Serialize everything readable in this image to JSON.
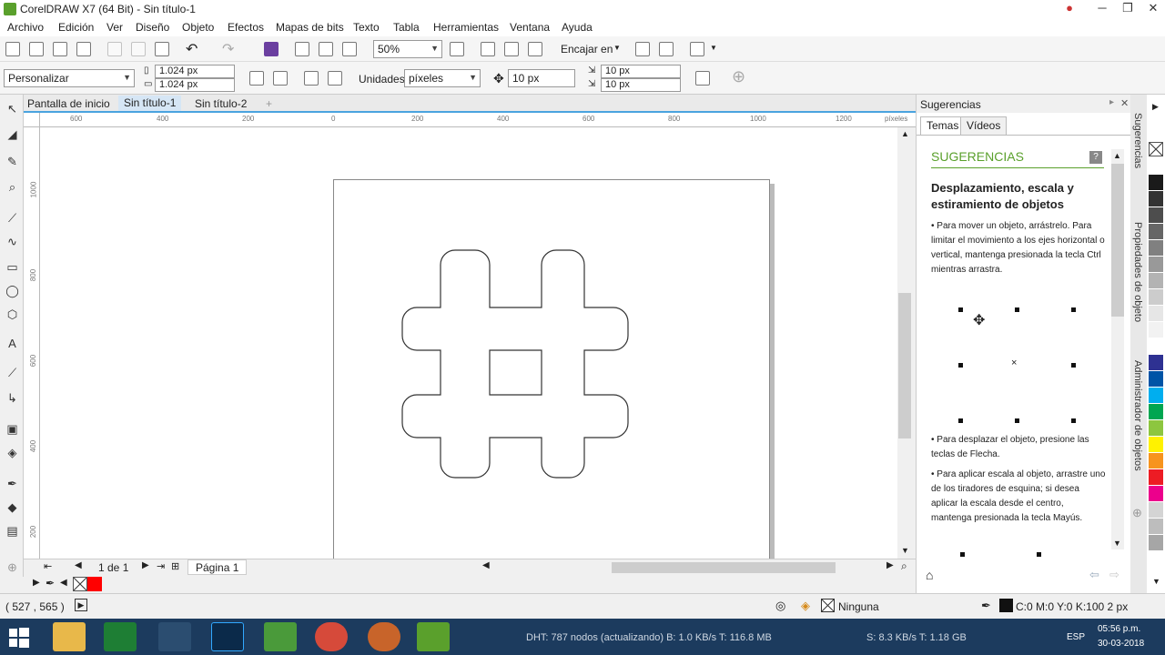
{
  "window": {
    "title": "CorelDRAW X7 (64 Bit) - Sin título-1"
  },
  "menu": [
    "Archivo",
    "Edición",
    "Ver",
    "Diseño",
    "Objeto",
    "Efectos",
    "Mapas de bits",
    "Texto",
    "Tabla",
    "Herramientas",
    "Ventana",
    "Ayuda"
  ],
  "toolbar": {
    "zoom": "50%",
    "snap": "Encajar en"
  },
  "propbar": {
    "preset": "Personalizar",
    "width": "1.024 px",
    "height": "1.024 px",
    "units_label": "Unidades:",
    "units": "píxeles",
    "nudge": "10 px",
    "dup_x": "10 px",
    "dup_y": "10 px"
  },
  "tabs": [
    "Pantalla de inicio",
    "Sin título-1",
    "Sin título-2"
  ],
  "ruler": {
    "h": [
      "600",
      "400",
      "200",
      "0",
      "200",
      "400",
      "600",
      "800",
      "1000",
      "1200"
    ],
    "h_unit": "píxeles",
    "v": [
      "1000",
      "800",
      "600",
      "400",
      "200"
    ],
    "v_unit": "píxeles"
  },
  "pagenav": {
    "counter": "1 de 1",
    "page": "Página 1"
  },
  "status": {
    "coords": "( 527  , 565  )",
    "fill": "Ninguna",
    "outline": "C:0 M:0 Y:0 K:100  2 px"
  },
  "docker": {
    "title": "Sugerencias",
    "tabs": [
      "Temas",
      "Vídeos"
    ],
    "heading": "SUGERENCIAS",
    "topic": "Desplazamiento, escala y estiramiento de objetos",
    "p1": "• Para mover un objeto, arrástrelo. Para limitar el movimiento a los ejes horizontal o vertical, mantenga presionada la tecla Ctrl mientras arrastra.",
    "p2": "• Para desplazar el objeto, presione las teclas de Flecha.",
    "p3": "• Para aplicar escala al objeto, arrastre uno de los tiradores de esquina; si desea aplicar la escala desde el centro, mantenga presionada la tecla Mayús."
  },
  "side_tabs": [
    "Sugerencias",
    "Propiedades de objeto",
    "Administrador de objetos"
  ],
  "palette": [
    "#ffffff",
    "#1a1a1a",
    "#333333",
    "#4d4d4d",
    "#666666",
    "#808080",
    "#999999",
    "#b3b3b3",
    "#cccccc",
    "#e6e6e6",
    "#f2f2f2",
    "#ffffff",
    "#2e3192",
    "#0054a6",
    "#00aeef",
    "#00a651",
    "#8dc63f",
    "#fff200",
    "#f7941d",
    "#ed1c24",
    "#ec008c",
    "#d4d4d4",
    "#bdbdbd",
    "#a6a6a6"
  ],
  "taskbar": {
    "net": "DHT: 787 nodos  (actualizando)    B: 1.0 KB/s T: 116.8 MB",
    "speed": "S: 8.3 KB/s T: 1.18 GB",
    "lang": "ESP",
    "time": "05:56 p.m.",
    "date": "30-03-2018"
  },
  "colors": {
    "accent": "#4aa3df",
    "tips_green": "#5aa02c",
    "taskbar": "#1c3b5e"
  }
}
